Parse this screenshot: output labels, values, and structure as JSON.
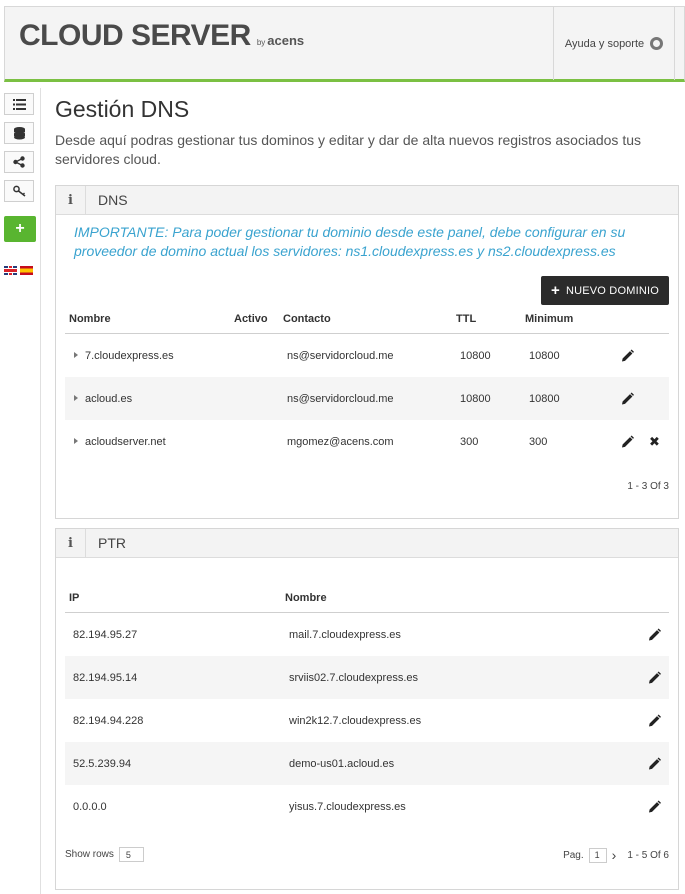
{
  "header": {
    "logo_main": "CLOUD SERVER",
    "logo_by": "by",
    "logo_brand": "acens",
    "support_label": "Ayuda y soporte"
  },
  "page": {
    "title": "Gestión DNS",
    "intro": "Desde aquí podras gestionar tus dominos y editar y dar de alta nuevos registros asociados tus servidores cloud."
  },
  "dns": {
    "panel_title": "DNS",
    "info_glyph": "i",
    "important": "IMPORTANTE: Para poder gestionar tu dominio desde este panel, debe configurar en su proveedor de domino actual los servidores: ns1.cloudexpress.es y ns2.cloudexpress.es",
    "new_button": "NUEVO DOMINIO",
    "columns": [
      "Nombre",
      "Activo",
      "Contacto",
      "TTL",
      "Minimum"
    ],
    "rows": [
      {
        "name": "7.cloudexpress.es",
        "contact": "ns@servidorcloud.me",
        "ttl": "10800",
        "minimum": "10800"
      },
      {
        "name": "acloud.es",
        "contact": "ns@servidorcloud.me",
        "ttl": "10800",
        "minimum": "10800"
      },
      {
        "name": "acloudserver.net",
        "contact": "mgomez@acens.com",
        "ttl": "300",
        "minimum": "300"
      }
    ],
    "pager": "1 - 3   Of 3"
  },
  "ptr": {
    "panel_title": "PTR",
    "info_glyph": "i",
    "columns": [
      "IP",
      "Nombre"
    ],
    "rows": [
      {
        "ip": "82.194.95.27",
        "name": "mail.7.cloudexpress.es"
      },
      {
        "ip": "82.194.95.14",
        "name": "srviis02.7.cloudexpress.es"
      },
      {
        "ip": "82.194.94.228",
        "name": "win2k12.7.cloudexpress.es"
      },
      {
        "ip": "52.5.239.94",
        "name": "demo-us01.acloud.es"
      },
      {
        "ip": "0.0.0.0",
        "name": "yisus.7.cloudexpress.es"
      }
    ],
    "show_rows_label": "Show rows",
    "show_rows_value": "5",
    "page_label": "Pag.",
    "page_value": "1",
    "next_glyph": "›",
    "pager": "1 - 5   Of 6"
  },
  "icons": {
    "list": "list-icon",
    "database": "database-icon",
    "share": "share-icon",
    "key": "key-icon",
    "add": "+",
    "close": "✖"
  },
  "colors": {
    "accent_green": "#7bc043",
    "add_green": "#59b530",
    "important_blue": "#3aa3cf",
    "dark_button": "#2b2b2b"
  }
}
